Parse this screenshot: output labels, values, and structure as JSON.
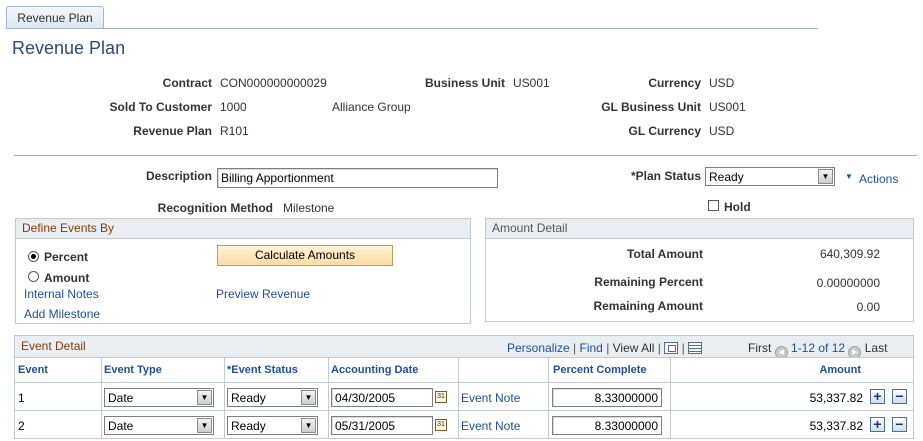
{
  "tab": {
    "label": "Revenue Plan"
  },
  "page_title": "Revenue Plan",
  "header": {
    "contract_label": "Contract",
    "contract_value": "CON000000000029",
    "business_unit_label": "Business Unit",
    "business_unit_value": "US001",
    "currency_label": "Currency",
    "currency_value": "USD",
    "sold_to_label": "Sold To Customer",
    "sold_to_value": "1000",
    "sold_to_name": "Alliance Group",
    "gl_bu_label": "GL Business Unit",
    "gl_bu_value": "US001",
    "revenue_plan_label": "Revenue Plan",
    "revenue_plan_value": "R101",
    "gl_currency_label": "GL Currency",
    "gl_currency_value": "USD"
  },
  "form": {
    "description_label": "Description",
    "description_value": "Billing Apportionment",
    "plan_status_label": "*Plan Status",
    "plan_status_value": "Ready",
    "actions_label": "Actions",
    "recognition_label": "Recognition Method",
    "recognition_value": "Milestone",
    "hold_label": "Hold"
  },
  "define_events": {
    "title": "Define Events By",
    "percent_label": "Percent",
    "amount_label": "Amount",
    "selected": "Percent",
    "calculate_button": "Calculate Amounts",
    "internal_notes": "Internal Notes",
    "preview_revenue": "Preview Revenue",
    "add_milestone": "Add Milestone"
  },
  "amount_detail": {
    "title": "Amount Detail",
    "total_label": "Total Amount",
    "total_value": "640,309.92",
    "remaining_pct_label": "Remaining Percent",
    "remaining_pct_value": "0.00000000",
    "remaining_amt_label": "Remaining Amount",
    "remaining_amt_value": "0.00"
  },
  "event_detail": {
    "title": "Event Detail",
    "personalize": "Personalize",
    "find": "Find",
    "view_all": "View All",
    "first": "First",
    "range": "1-12 of 12",
    "last": "Last",
    "columns": [
      "Event",
      "Event Type",
      "*Event Status",
      "Accounting Date",
      "Percent Complete",
      "Amount"
    ],
    "rows": [
      {
        "event": "1",
        "type": "Date",
        "status": "Ready",
        "date": "04/30/2005",
        "note": "Event Note",
        "percent": "8.33000000",
        "amount": "53,337.82"
      },
      {
        "event": "2",
        "type": "Date",
        "status": "Ready",
        "date": "05/31/2005",
        "note": "Event Note",
        "percent": "8.33000000",
        "amount": "53,337.82"
      }
    ]
  },
  "colors": {
    "link": "#1f4f9a",
    "section_title": "#8c3b08",
    "page_title": "#2b4b7c"
  }
}
